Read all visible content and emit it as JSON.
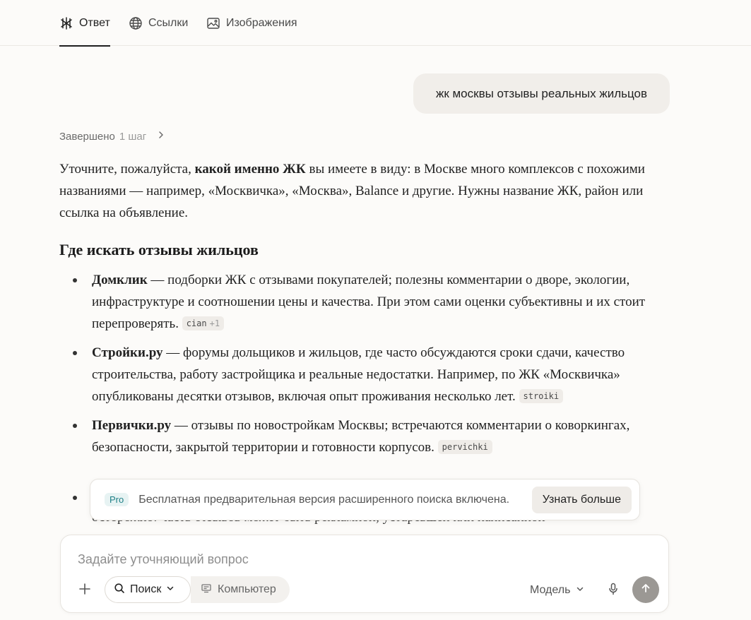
{
  "tabs": [
    {
      "label": "Ответ",
      "icon": "answer-icon",
      "active": true
    },
    {
      "label": "Ссылки",
      "icon": "globe-icon"
    },
    {
      "label": "Изображения",
      "icon": "image-icon"
    }
  ],
  "query": "жк москвы отзывы реальных жильцов",
  "steps": {
    "label": "Завершено",
    "count": "1 шаг"
  },
  "answer": {
    "intro": {
      "before": "Уточните, пожалуйста, ",
      "bold": "какой именно ЖК",
      "after": " вы имеете в виду: в Москве много комплексов с похожими названиями — например, «Москвичка», «Москва», Balance и другие. Нужны название ЖК, район или ссылка на объявление."
    },
    "heading": "Где искать отзывы жильцов",
    "items": [
      {
        "title": "Домклик",
        "text": " — подборки ЖК с отзывами покупателей; полезны комментарии о дворе, экологии, инфраструктуре и соотношении цены и качества. При этом сами оценки субъективны и их стоит перепроверять. ",
        "cite": "cian",
        "cite_extra": "+1"
      },
      {
        "title": "Стройки.ру",
        "text": " — форумы дольщиков и жильцов, где часто обсуждаются сроки сдачи, качество строительства, работу застройщика и реальные недостатки. Например, по ЖК «Москвичка» опубликованы десятки отзывов, включая опыт проживания несколько лет. ",
        "cite": "stroiki"
      },
      {
        "title": "Первички.ру",
        "text": " — отзывы по новостройкам Москвы; встречаются комментарии о коворкингах, безопасности, закрытой территории и готовности корпусов. ",
        "cite": "pervichki"
      }
    ],
    "faded_line": "осторожно: часть отзывов может быть рекламной, устаревшей или написанной"
  },
  "pro_banner": {
    "badge": "Pro",
    "text": "Бесплатная предварительная версия расширенного поиска включена.",
    "button": "Узнать больше"
  },
  "composer": {
    "placeholder": "Задайте уточняющий вопрос",
    "search_label": "Поиск",
    "computer_label": "Компьютер",
    "model_label": "Модель"
  }
}
